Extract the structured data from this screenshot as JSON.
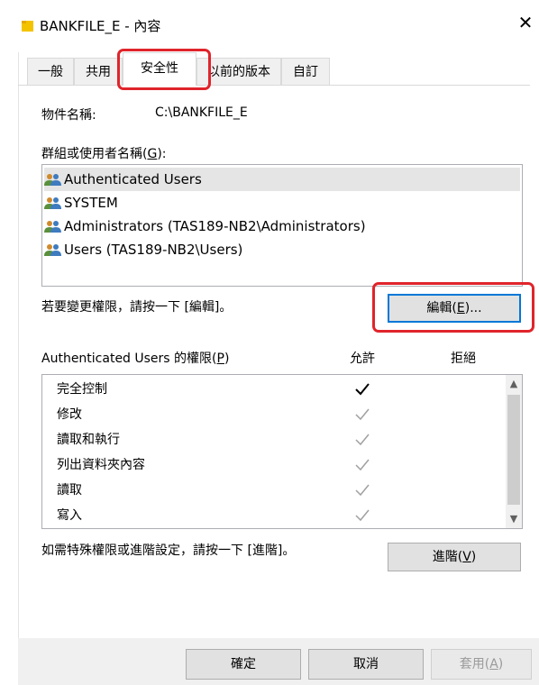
{
  "window": {
    "title": "BANKFILE_E - 內容",
    "close_glyph": "✕"
  },
  "tabs": [
    {
      "label": "一般"
    },
    {
      "label": "共用"
    },
    {
      "label": "安全性",
      "active": true
    },
    {
      "label": "以前的版本"
    },
    {
      "label": "自訂"
    }
  ],
  "object_name": {
    "label": "物件名稱:",
    "value": "C:\\BANKFILE_E"
  },
  "groups": {
    "label_prefix": "群組或使用者名稱(",
    "label_key": "G",
    "label_suffix": "):",
    "items": [
      {
        "name": "Authenticated Users",
        "selected": true
      },
      {
        "name": "SYSTEM"
      },
      {
        "name": "Administrators (TAS189-NB2\\Administrators)"
      },
      {
        "name": "Users (TAS189-NB2\\Users)"
      }
    ]
  },
  "change_hint": "若要變更權限，請按一下 [編輯]。",
  "edit_button": {
    "prefix": "編輯(",
    "key": "E",
    "suffix": ")..."
  },
  "permissions": {
    "label_prefix": "Authenticated Users 的權限(",
    "label_key": "P",
    "label_suffix": ")",
    "allow_header": "允許",
    "deny_header": "拒絕",
    "rows": [
      {
        "name": "完全控制",
        "allow": "enabled"
      },
      {
        "name": "修改",
        "allow": "inherited"
      },
      {
        "name": "讀取和執行",
        "allow": "inherited"
      },
      {
        "name": "列出資料夾內容",
        "allow": "inherited"
      },
      {
        "name": "讀取",
        "allow": "inherited"
      },
      {
        "name": "寫入",
        "allow": "inherited"
      }
    ]
  },
  "advanced_hint": "如需特殊權限或進階設定，請按一下 [進階]。",
  "advanced_button": {
    "prefix": "進階(",
    "key": "V",
    "suffix": ")"
  },
  "footer": {
    "ok": "確定",
    "cancel": "取消",
    "apply_prefix": "套用(",
    "apply_key": "A",
    "apply_suffix": ")"
  },
  "colors": {
    "highlight": "#e0242b",
    "focus": "#0078d7",
    "check_enabled": "#000000",
    "check_inherited": "#a0a0a0"
  }
}
